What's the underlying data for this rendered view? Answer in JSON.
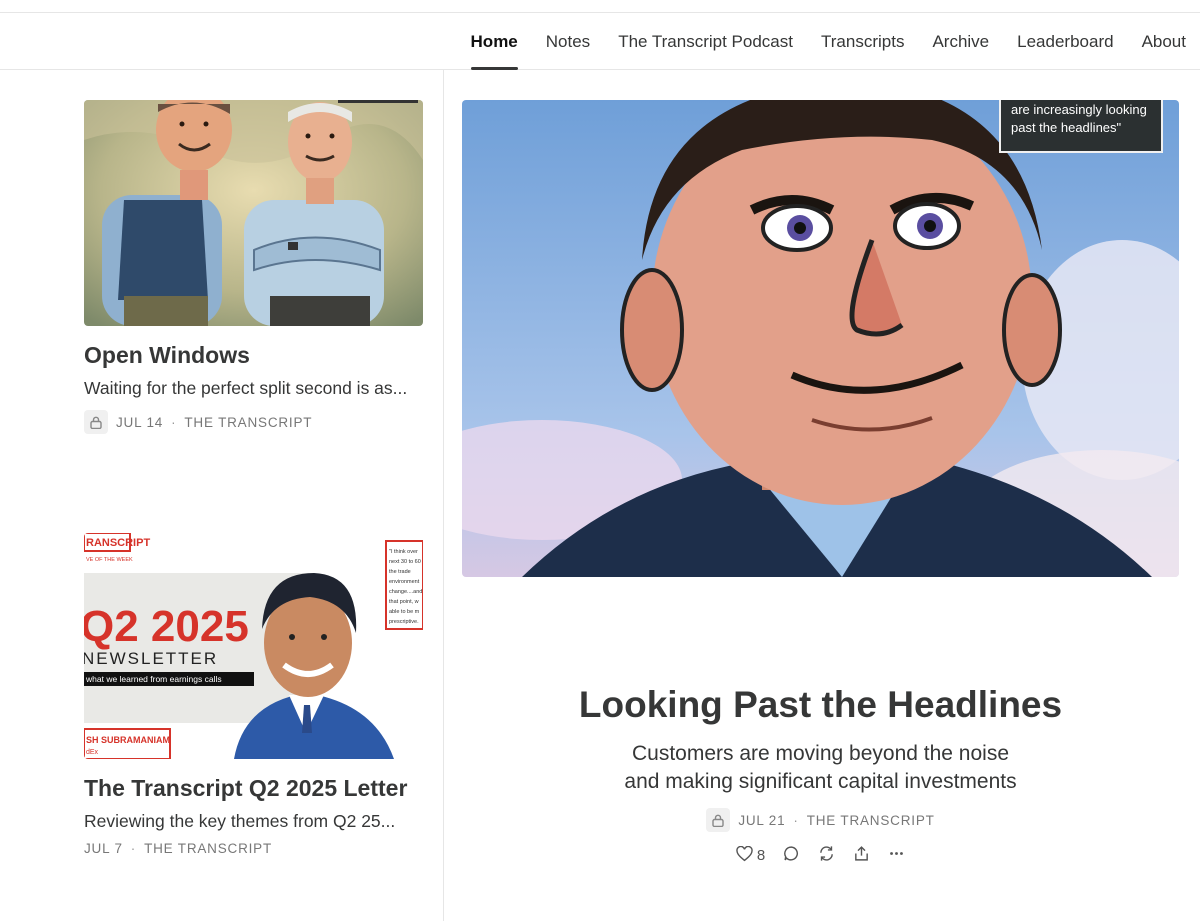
{
  "nav": {
    "items": [
      "Home",
      "Notes",
      "The Transcript Podcast",
      "Transcripts",
      "Archive",
      "Leaderboard",
      "About"
    ],
    "active": "Home"
  },
  "posts": [
    {
      "title": "Open Windows",
      "subtitle": "Waiting for the perfect split second is as...",
      "date": "JUL 14",
      "author": "THE TRANSCRIPT",
      "locked": true
    },
    {
      "title": "The Transcript Q2 2025 Letter",
      "subtitle": "Reviewing the key themes from Q2 25...",
      "date": "JUL 7",
      "author": "THE TRANSCRIPT",
      "locked": false,
      "thumb_text": {
        "brand": "RANSCRIPT",
        "tagline": "VE OF THE WEEK",
        "big": "Q2 2025",
        "newsletter": "NEWSLETTER",
        "caption": "what we learned from earnings calls",
        "name": "SH SUBRAMANIAM",
        "company": "dEx",
        "quote_lines": [
          "\"I think over",
          "next 30 to 60",
          "the trade",
          "environment",
          "change....and",
          "that point, w",
          "able to be m",
          "prescriptive."
        ]
      }
    }
  ],
  "featured": {
    "title": "Looking Past the Headlines",
    "subtitle_line1": "Customers are moving beyond the noise",
    "subtitle_line2": "and making significant capital investments",
    "date": "JUL 21",
    "author": "THE TRANSCRIPT",
    "locked": true,
    "likes": "8",
    "image_quote_line1": "are increasingly looking",
    "image_quote_line2": "past the headlines\""
  },
  "separator": "·",
  "colors": {
    "brand_red": "#d6332a",
    "text": "#363737",
    "meta": "#777777"
  }
}
